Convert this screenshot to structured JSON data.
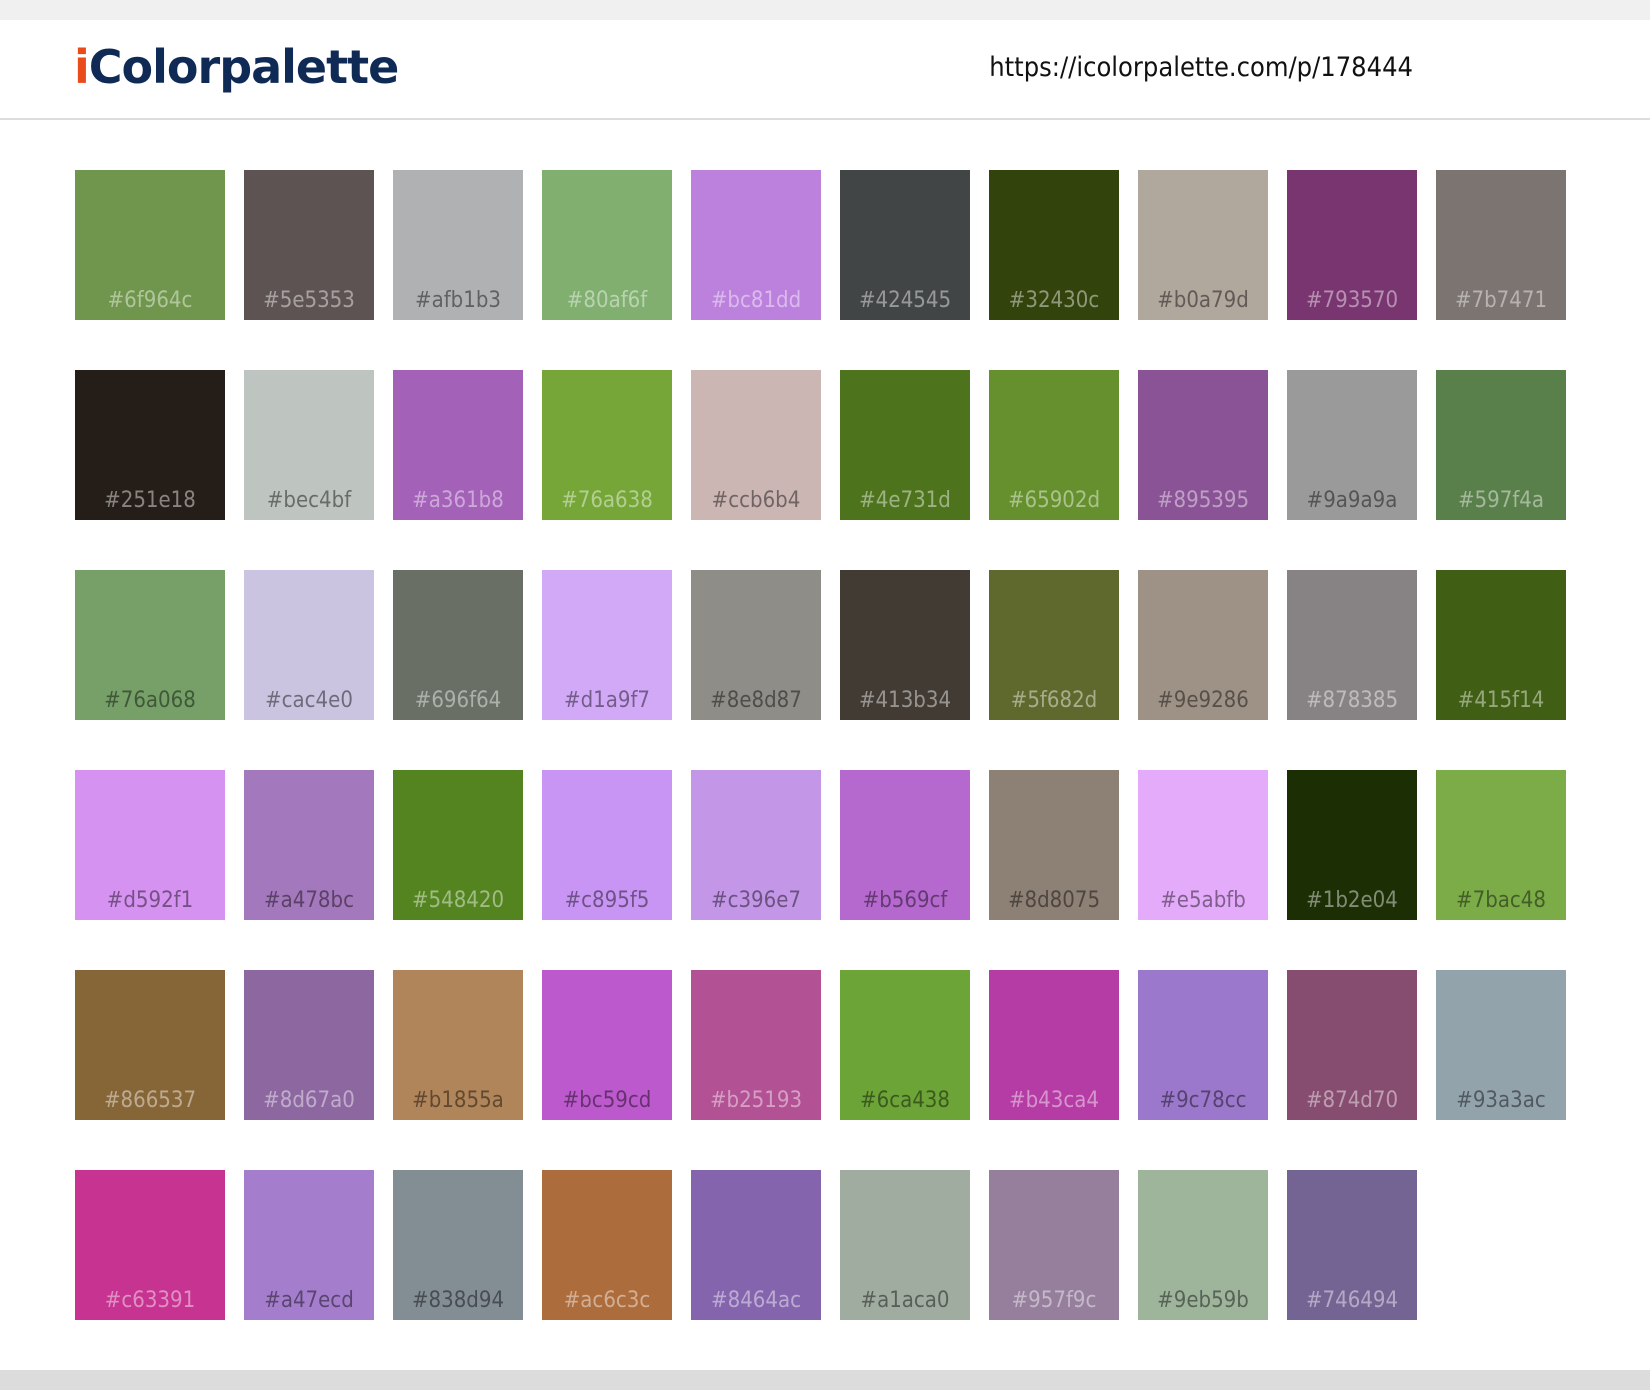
{
  "header": {
    "logo_i": "i",
    "logo_rest": "Colorpalette",
    "url": "https://icolorpalette.com/p/178444"
  },
  "swatches": [
    {
      "hex": "#6f964c",
      "label": "#6f964c",
      "light": false
    },
    {
      "hex": "#5e5353",
      "label": "#5e5353",
      "light": false
    },
    {
      "hex": "#afb1b3",
      "label": "#afb1b3",
      "light": true
    },
    {
      "hex": "#80af6f",
      "label": "#80af6f",
      "light": false
    },
    {
      "hex": "#bc81dd",
      "label": "#bc81dd",
      "light": false
    },
    {
      "hex": "#424545",
      "label": "#424545",
      "light": false
    },
    {
      "hex": "#32430c",
      "label": "#32430c",
      "light": false
    },
    {
      "hex": "#b0a79d",
      "label": "#b0a79d",
      "light": true
    },
    {
      "hex": "#793570",
      "label": "#793570",
      "light": false
    },
    {
      "hex": "#7b7471",
      "label": "#7b7471",
      "light": false
    },
    {
      "hex": "#251e18",
      "label": "#251e18",
      "light": false
    },
    {
      "hex": "#bec4bf",
      "label": "#bec4bf",
      "light": true
    },
    {
      "hex": "#a361b8",
      "label": "#a361b8",
      "light": false
    },
    {
      "hex": "#76a638",
      "label": "#76a638",
      "light": false
    },
    {
      "hex": "#ccb6b4",
      "label": "#ccb6b4",
      "light": true
    },
    {
      "hex": "#4e731d",
      "label": "#4e731d",
      "light": false
    },
    {
      "hex": "#65902d",
      "label": "#65902d",
      "light": false
    },
    {
      "hex": "#895395",
      "label": "#895395",
      "light": false
    },
    {
      "hex": "#9a9a9a",
      "label": "#9a9a9a",
      "light": true
    },
    {
      "hex": "#597f4a",
      "label": "#597f4a",
      "light": false
    },
    {
      "hex": "#76a068",
      "label": "#76a068",
      "light": true
    },
    {
      "hex": "#cac4e0",
      "label": "#cac4e0",
      "light": true
    },
    {
      "hex": "#696f64",
      "label": "#696f64",
      "light": false
    },
    {
      "hex": "#d1a9f7",
      "label": "#d1a9f7",
      "light": true
    },
    {
      "hex": "#8e8d87",
      "label": "#8e8d87",
      "light": true
    },
    {
      "hex": "#413b34",
      "label": "#413b34",
      "light": false
    },
    {
      "hex": "#5f682d",
      "label": "#5f682d",
      "light": false
    },
    {
      "hex": "#9e9286",
      "label": "#9e9286",
      "light": true
    },
    {
      "hex": "#878385",
      "label": "#878385",
      "light": false
    },
    {
      "hex": "#415f14",
      "label": "#415f14",
      "light": false
    },
    {
      "hex": "#d592f1",
      "label": "#d592f1",
      "light": true
    },
    {
      "hex": "#a478bc",
      "label": "#a478bc",
      "light": true
    },
    {
      "hex": "#548420",
      "label": "#548420",
      "light": false
    },
    {
      "hex": "#c895f5",
      "label": "#c895f5",
      "light": true
    },
    {
      "hex": "#c396e7",
      "label": "#c396e7",
      "light": true
    },
    {
      "hex": "#b569cf",
      "label": "#b569cf",
      "light": true
    },
    {
      "hex": "#8d8075",
      "label": "#8d8075",
      "light": true
    },
    {
      "hex": "#e5abfb",
      "label": "#e5abfb",
      "light": true
    },
    {
      "hex": "#1b2e04",
      "label": "#1b2e04",
      "light": false
    },
    {
      "hex": "#7bac48",
      "label": "#7bac48",
      "light": true
    },
    {
      "hex": "#866537",
      "label": "#866537",
      "light": false
    },
    {
      "hex": "#8d67a0",
      "label": "#8d67a0",
      "light": false
    },
    {
      "hex": "#b1855a",
      "label": "#b1855a",
      "light": true
    },
    {
      "hex": "#bc59cd",
      "label": "#bc59cd",
      "light": true
    },
    {
      "hex": "#b25193",
      "label": "#b25193",
      "light": false
    },
    {
      "hex": "#6ca438",
      "label": "#6ca438",
      "light": true
    },
    {
      "hex": "#b43ca4",
      "label": "#b43ca4",
      "light": false
    },
    {
      "hex": "#9c78cc",
      "label": "#9c78cc",
      "light": true
    },
    {
      "hex": "#874d70",
      "label": "#874d70",
      "light": false
    },
    {
      "hex": "#93a3ac",
      "label": "#93a3ac",
      "light": true
    },
    {
      "hex": "#c63391",
      "label": "#c63391",
      "light": false
    },
    {
      "hex": "#a47ecd",
      "label": "#a47ecd",
      "light": true
    },
    {
      "hex": "#838d94",
      "label": "#838d94",
      "light": true
    },
    {
      "hex": "#ac6c3c",
      "label": "#ac6c3c",
      "light": false
    },
    {
      "hex": "#8464ac",
      "label": "#8464ac",
      "light": false
    },
    {
      "hex": "#a1aca0",
      "label": "#a1aca0",
      "light": true
    },
    {
      "hex": "#957f9c",
      "label": "#957f9c",
      "light": false
    },
    {
      "hex": "#9eb59b",
      "label": "#9eb59b",
      "light": true
    },
    {
      "hex": "#746494",
      "label": "#746494",
      "light": false
    }
  ]
}
